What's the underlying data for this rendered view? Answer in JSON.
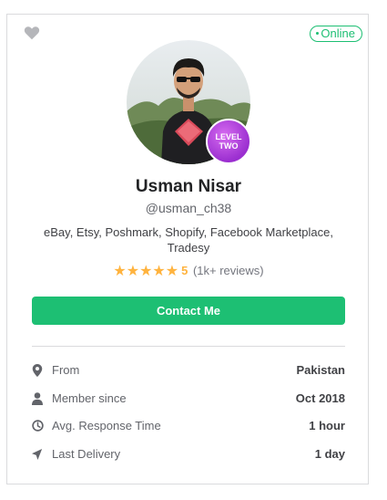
{
  "card": {
    "status": "Online",
    "level_line1": "LEVEL",
    "level_line2": "TWO",
    "name": "Usman Nisar",
    "username": "@usman_ch38",
    "skills": "eBay, Etsy, Poshmark, Shopify, Facebook Marketplace, Tradesy",
    "rating": {
      "stars": 5,
      "score": "5",
      "count": "(1k+ reviews)"
    },
    "contact_label": "Contact Me",
    "details": [
      {
        "icon": "location-pin-icon",
        "label": "From",
        "value": "Pakistan"
      },
      {
        "icon": "user-icon",
        "label": "Member since",
        "value": "Oct 2018"
      },
      {
        "icon": "clock-icon",
        "label": "Avg. Response Time",
        "value": "1 hour"
      },
      {
        "icon": "paper-plane-icon",
        "label": "Last Delivery",
        "value": "1 day"
      }
    ]
  },
  "colors": {
    "accent": "#1dbf73",
    "star": "#ffb33e",
    "level_badge": "#b545e0"
  }
}
